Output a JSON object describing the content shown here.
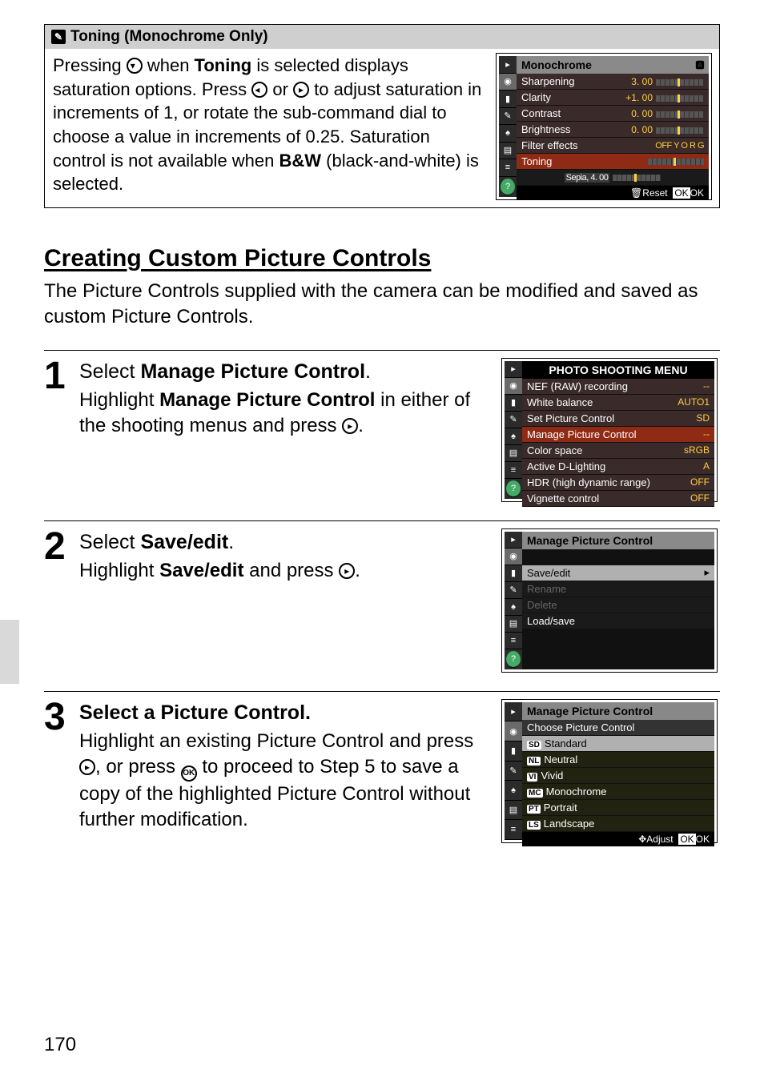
{
  "note": {
    "title": "Toning (Monochrome Only)",
    "body_parts": {
      "p1": "Pressing ",
      "p2": " when ",
      "toning": "Toning",
      "p3": " is selected displays saturation options.  Press ",
      "p4": " or ",
      "p5": " to adjust saturation in increments of 1, or rotate the sub-command dial to choose a value in increments of 0.25.  Saturation control is not available when ",
      "bw": "B&W",
      "p6": " (black-and-white) is selected."
    }
  },
  "lcd_toning": {
    "header": "Monochrome",
    "rows": [
      {
        "label": "Sharpening",
        "val": "3. 00"
      },
      {
        "label": "Clarity",
        "val": "+1. 00"
      },
      {
        "label": "Contrast",
        "val": "0. 00"
      },
      {
        "label": "Brightness",
        "val": "0. 00"
      },
      {
        "label": "Filter effects",
        "val": "OFF Y O R G"
      },
      {
        "label": "Toning",
        "val": ""
      }
    ],
    "sepia": "Sepia, 4. 00",
    "foot_reset": "Reset",
    "foot_ok": "OK"
  },
  "section": {
    "heading": "Creating Custom Picture Controls",
    "intro": "The Picture Controls supplied with the camera can be modified and saved as custom Picture Controls."
  },
  "steps": {
    "s1": {
      "num": "1",
      "title_a": "Select ",
      "title_b": "Manage Picture Control",
      "title_c": ".",
      "desc_a": "Highlight ",
      "desc_b": "Manage Picture Control",
      "desc_c": " in either of the shooting menus and press ",
      "desc_d": "."
    },
    "s2": {
      "num": "2",
      "title_a": "Select ",
      "title_b": "Save/edit",
      "title_c": ".",
      "desc_a": "Highlight ",
      "desc_b": "Save/edit",
      "desc_c": " and press ",
      "desc_d": "."
    },
    "s3": {
      "num": "3",
      "title": "Select a Picture Control.",
      "desc_a": "Highlight an existing Picture Control and press ",
      "desc_b": ", or press ",
      "desc_c": " to proceed to Step 5 to save a copy of the highlighted Picture Control without further modification."
    }
  },
  "lcd_menu": {
    "header": "PHOTO SHOOTING MENU",
    "rows": [
      {
        "label": "NEF (RAW) recording",
        "val": "--"
      },
      {
        "label": "White balance",
        "val": "AUTO1"
      },
      {
        "label": "Set Picture Control",
        "val": "SD"
      },
      {
        "label": "Manage Picture Control",
        "val": "--",
        "hl": true
      },
      {
        "label": "Color space",
        "val": "sRGB"
      },
      {
        "label": "Active D-Lighting",
        "val": "A"
      },
      {
        "label": "HDR (high dynamic range)",
        "val": "OFF"
      },
      {
        "label": "Vignette control",
        "val": "OFF"
      }
    ]
  },
  "lcd_save": {
    "header": "Manage Picture Control",
    "rows": [
      {
        "label": "Save/edit",
        "sel": true
      },
      {
        "label": "Rename",
        "dis": true
      },
      {
        "label": "Delete",
        "dis": true
      },
      {
        "label": "Load/save"
      }
    ]
  },
  "lcd_choose": {
    "header": "Manage Picture Control",
    "sub": "Choose Picture Control",
    "rows": [
      {
        "code": "SD",
        "label": "Standard",
        "hl": true
      },
      {
        "code": "NL",
        "label": "Neutral"
      },
      {
        "code": "VI",
        "label": "Vivid"
      },
      {
        "code": "MC",
        "label": "Monochrome"
      },
      {
        "code": "PT",
        "label": "Portrait"
      },
      {
        "code": "LS",
        "label": "Landscape"
      }
    ],
    "foot_adjust": "Adjust",
    "foot_ok": "OK"
  },
  "page_number": "170"
}
